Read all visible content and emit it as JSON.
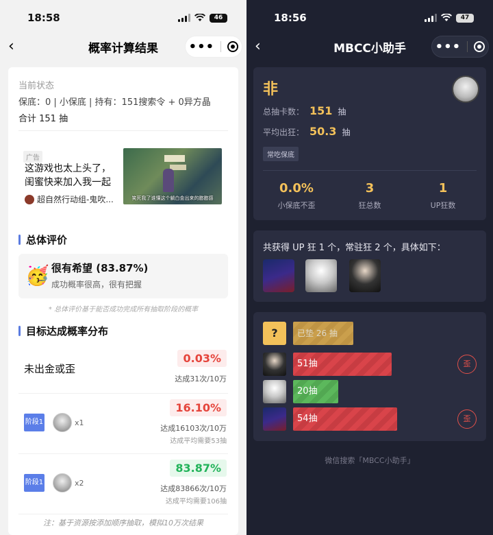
{
  "left": {
    "status": {
      "time": "18:58",
      "battery": "46"
    },
    "nav": {
      "title": "概率计算结果"
    },
    "state": {
      "label": "当前状态",
      "line": "保底：0 | 小保底 | 持有：151搜索令 + 0异方晶",
      "total": "合计 151 抽"
    },
    "ad": {
      "tag": "广告",
      "text": "这游戏也太上头了，闺蜜快来加入我一起",
      "source": "超自然行动组-鬼吹...",
      "image_caption": "笑死我了谁懂这个躺白金出来的憨憨感"
    },
    "evaluation": {
      "section_title": "总体评价",
      "main": "很有希望 (83.87%)",
      "sub": "成功概率很高，很有把握",
      "note": "* 总体评价基于能否成功完成所有抽取阶段的概率"
    },
    "distribution": {
      "section_title": "目标达成概率分布",
      "rows": [
        {
          "label": "未出金或歪",
          "pct": "0.03%",
          "count": "达成31次/10万",
          "avg": ""
        },
        {
          "stage": "阶段1",
          "mult": "x1",
          "pct": "16.10%",
          "count": "达成16103次/10万",
          "avg": "达成平均需要53抽"
        },
        {
          "stage": "阶段1",
          "mult": "x2",
          "pct": "83.87%",
          "count": "达成83866次/10万",
          "avg": "达成平均需要106抽"
        }
      ],
      "footnote": "注：基于资源按添加顺序抽取，模拟10万次结果"
    }
  },
  "right": {
    "status": {
      "time": "18:56",
      "battery": "47"
    },
    "nav": {
      "title": "MBCC小助手"
    },
    "profile": {
      "verdict": "非",
      "total_label": "总抽卡数：",
      "total_value": "151",
      "total_unit": "抽",
      "avg_label": "平均出狂：",
      "avg_value": "50.3",
      "avg_unit": "抽",
      "chip": "常吃保底",
      "stats": [
        {
          "value": "0.0%",
          "label": "小保底不歪"
        },
        {
          "value": "3",
          "label": "狂总数"
        },
        {
          "value": "1",
          "label": "UP狂数"
        }
      ]
    },
    "summary": {
      "text": "共获得 UP 狂 1 个，常驻狂 2 个，具体如下："
    },
    "history": {
      "pending_label": "已垫 26 抽",
      "rows": [
        {
          "label": "51抽",
          "fill": 0.55,
          "color": "red",
          "badge": "歪"
        },
        {
          "label": "20抽",
          "fill": 0.25,
          "color": "green",
          "badge": ""
        },
        {
          "label": "54抽",
          "fill": 0.58,
          "color": "red",
          "badge": "歪"
        }
      ]
    },
    "footer": "微信搜索「MBCC小助手」"
  }
}
